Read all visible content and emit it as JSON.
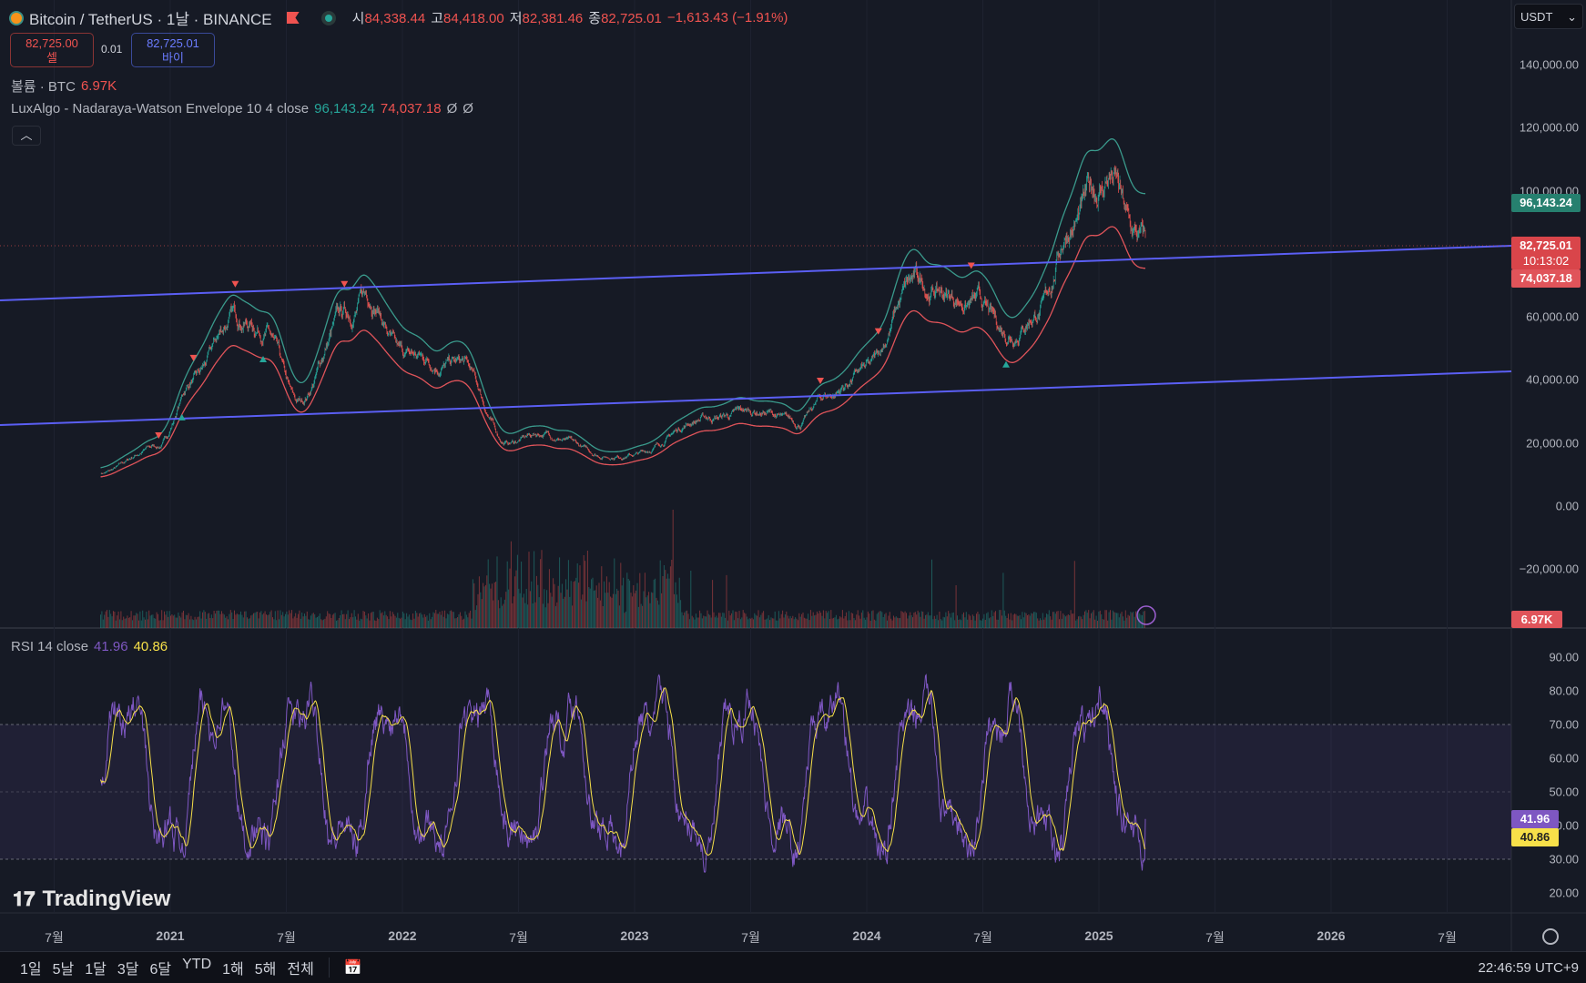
{
  "header": {
    "symbol": "Bitcoin / TetherUS · 1날 · BINANCE",
    "open_label": "시",
    "open": "84,338.44",
    "high_label": "고",
    "high": "84,418.00",
    "low_label": "저",
    "low": "82,381.46",
    "close_label": "종",
    "close": "82,725.01",
    "change": "−1,613.43 (−1.91%)"
  },
  "trade": {
    "sell_price": "82,725.00",
    "sell_label": "셀",
    "spread": "0.01",
    "buy_price": "82,725.01",
    "buy_label": "바이"
  },
  "volume_legend": {
    "label": "볼륨 · BTC",
    "value": "6.97K"
  },
  "envelope_legend": {
    "label": "LuxAlgo - Nadaraya-Watson Envelope 10 4 close",
    "upper": "96,143.24",
    "lower": "74,037.18",
    "na1": "Ø",
    "na2": "Ø"
  },
  "rsi_legend": {
    "label": "RSI 14 close",
    "rsi": "41.96",
    "ma": "40.86"
  },
  "currency": "USDT",
  "price_axis": [
    "140,000.00",
    "120,000.00",
    "100,000.00",
    "60,000.00",
    "40,000.00",
    "20,000.00",
    "0.00",
    "−20,000.00"
  ],
  "price_axis_values": [
    140000,
    120000,
    100000,
    60000,
    40000,
    20000,
    0,
    -20000
  ],
  "badges": {
    "upper": "96,143.24",
    "last": "82,725.01",
    "countdown": "10:13:02",
    "lower": "74,037.18",
    "volume": "6.97K",
    "rsi": "41.96",
    "rsi_ma": "40.86"
  },
  "rsi_axis": [
    "90.00",
    "80.00",
    "70.00",
    "60.00",
    "50.00",
    "40.00",
    "30.00",
    "20.00"
  ],
  "time_axis": [
    "7월",
    "2021",
    "7월",
    "2022",
    "7월",
    "2023",
    "7월",
    "2024",
    "7월",
    "2025",
    "7월",
    "2026",
    "7월"
  ],
  "time_axis_years": [
    2020.5,
    2021,
    2021.5,
    2022,
    2022.5,
    2023,
    2023.5,
    2024,
    2024.5,
    2025,
    2025.5,
    2026,
    2026.5
  ],
  "price_keypoints": [
    [
      2020.7,
      10500
    ],
    [
      2020.95,
      19000
    ],
    [
      2021.1,
      40000
    ],
    [
      2021.28,
      60000
    ],
    [
      2021.4,
      57000
    ],
    [
      2021.55,
      32000
    ],
    [
      2021.75,
      60000
    ],
    [
      2021.86,
      67000
    ],
    [
      2022.0,
      47000
    ],
    [
      2022.25,
      45000
    ],
    [
      2022.45,
      20000
    ],
    [
      2022.6,
      23000
    ],
    [
      2022.88,
      16000
    ],
    [
      2023.0,
      16500
    ],
    [
      2023.3,
      28000
    ],
    [
      2023.55,
      30000
    ],
    [
      2023.7,
      26000
    ],
    [
      2023.83,
      35000
    ],
    [
      2024.0,
      43000
    ],
    [
      2024.2,
      70000
    ],
    [
      2024.45,
      65000
    ],
    [
      2024.6,
      55000
    ],
    [
      2024.75,
      63000
    ],
    [
      2024.88,
      90000
    ],
    [
      2025.0,
      100000
    ],
    [
      2025.05,
      105000
    ],
    [
      2025.15,
      85000
    ],
    [
      2025.2,
      82725
    ]
  ],
  "ranges": [
    "1일",
    "5날",
    "1달",
    "3달",
    "6달",
    "YTD",
    "1해",
    "5해",
    "전체"
  ],
  "clock": "22:46:59 UTC+9",
  "brand": "TradingView",
  "colors": {
    "bg": "#161a25",
    "up": "#26a69a",
    "down": "#f05350",
    "channel": "#5b5ff5",
    "rsi": "#7e57c2",
    "rsi_ma": "#f7e049"
  }
}
